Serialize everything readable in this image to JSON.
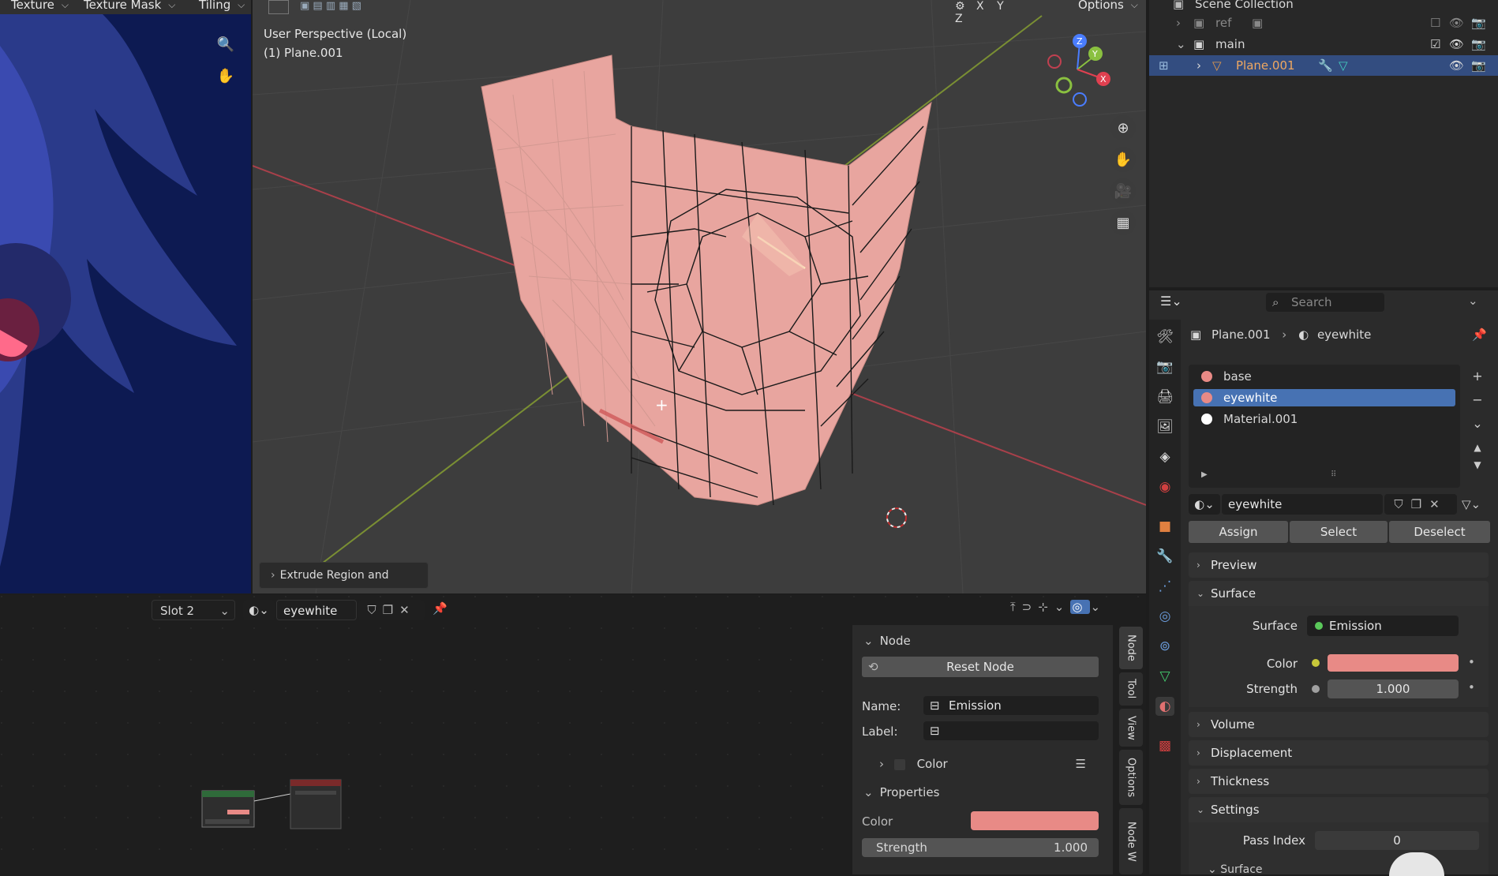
{
  "image_editor": {
    "menu_texture": "Texture",
    "menu_texture_mask": "Texture Mask",
    "menu_tiling": "Tiling"
  },
  "viewport": {
    "header_axes": [
      "X",
      "Y",
      "Z"
    ],
    "options_label": "Options",
    "overlay_line1": "User Perspective (Local)",
    "overlay_line2": "(1) Plane.001",
    "redo_panel_label": "Extrude Region and Shrink/",
    "gizmo_axes": [
      "Z",
      "Y",
      "X"
    ]
  },
  "outliner": {
    "title": "Scene Collection",
    "rows": [
      {
        "label": "ref"
      },
      {
        "label": "main"
      },
      {
        "label": "Plane.001"
      }
    ]
  },
  "properties": {
    "search_placeholder": "Search",
    "breadcrumb_object": "Plane.001",
    "breadcrumb_material": "eyewhite",
    "material_slots": [
      {
        "name": "base",
        "color": "#e88a86"
      },
      {
        "name": "eyewhite",
        "color": "#e88a86"
      },
      {
        "name": "Material.001",
        "color": "#ffffff"
      }
    ],
    "selected_slot": "eyewhite",
    "material_name": "eyewhite",
    "assign_label": "Assign",
    "select_label": "Select",
    "deselect_label": "Deselect",
    "panels": {
      "preview": "Preview",
      "surface": "Surface",
      "volume": "Volume",
      "displacement": "Displacement",
      "thickness": "Thickness",
      "settings": "Settings",
      "surface_sub": "Surface"
    },
    "surface_label": "Surface",
    "surface_value": "Emission",
    "color_label": "Color",
    "color_value": "#e88a86",
    "strength_label": "Strength",
    "strength_value": "1.000",
    "pass_index_label": "Pass Index",
    "pass_index_value": "0"
  },
  "shader_editor": {
    "slot_label": "Slot 2",
    "material_name": "eyewhite",
    "node_panel": {
      "node_header": "Node",
      "reset_label": "Reset Node",
      "name_label": "Name:",
      "name_value": "Emission",
      "label_label": "Label:",
      "label_value": "",
      "color_label": "Color",
      "properties_header": "Properties",
      "prop_color_label": "Color",
      "prop_color_value": "#e88a86",
      "strength_label": "Strength",
      "strength_value": "1.000"
    },
    "side_tabs": [
      "Node",
      "Tool",
      "View",
      "Options",
      "Node W"
    ]
  },
  "colors": {
    "accent_selection": "#334d80",
    "mesh": "#e8a59f",
    "emission_green": "#5ac85a",
    "axis_red": "#c8404a",
    "axis_green": "#8aa83a"
  }
}
